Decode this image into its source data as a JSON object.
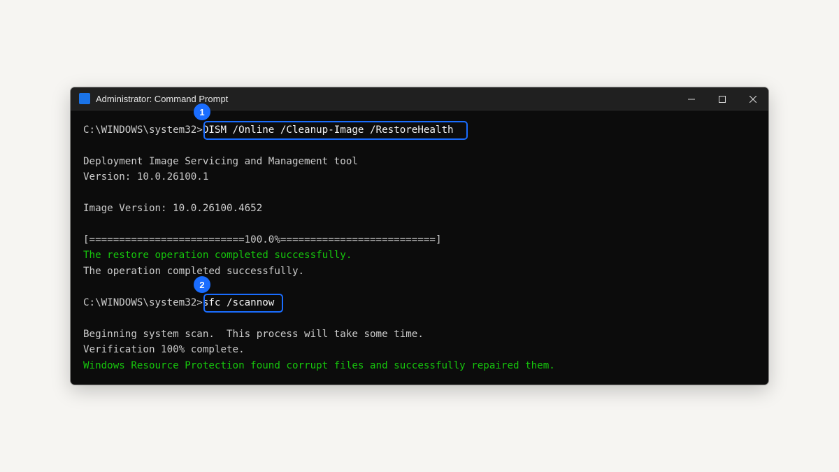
{
  "window": {
    "title": "Administrator: Command Prompt",
    "icon": "command-prompt-icon",
    "controls": {
      "minimize_icon": "minimize-icon",
      "maximize_icon": "maximize-icon",
      "close_icon": "close-icon"
    }
  },
  "console": {
    "prompt1": "C:\\WINDOWS\\system32>",
    "command1": "DISM /Online /Cleanup-Image /RestoreHealth",
    "out1": "Deployment Image Servicing and Management tool",
    "out2": "Version: 10.0.26100.1",
    "out3": "Image Version: 10.0.26100.4652",
    "progress": "[==========================100.0%==========================]",
    "success1": "The restore operation completed successfully.",
    "out4": "The operation completed successfully.",
    "prompt2": "C:\\WINDOWS\\system32>",
    "command2": "sfc /scannow",
    "out5": "Beginning system scan.  This process will take some time.",
    "out6": "Verification 100% complete.",
    "success2": "Windows Resource Protection found corrupt files and successfully repaired them."
  },
  "annotations": {
    "step1": "1",
    "step2": "2"
  },
  "colors": {
    "accent": "#1a6dff",
    "success_text": "#16c60c",
    "console_bg": "#0c0c0c",
    "page_bg": "#f6f5f2"
  }
}
